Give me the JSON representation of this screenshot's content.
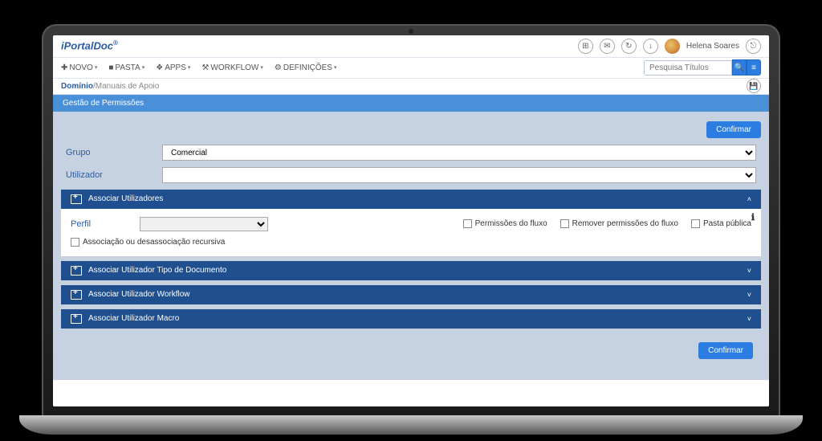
{
  "brand": "iPortalDoc",
  "brand_sup": "®",
  "user": "Helena Soares",
  "menu": {
    "novo": "NOVO",
    "pasta": "PASTA",
    "apps": "APPS",
    "workflow": "WORKFLOW",
    "defin": "DEFINIÇÕES"
  },
  "search": {
    "placeholder": "Pesquisa Títulos"
  },
  "breadcrumb": {
    "root": "Domínio",
    "sep": "/",
    "child": "Manuais de Apoio"
  },
  "section_title": "Gestão de Permissões",
  "confirm": "Confirmar",
  "labels": {
    "grupo": "Grupo",
    "utilizador": "Utilizador",
    "perfil": "Perfil"
  },
  "values": {
    "grupo": "Comercial",
    "utilizador": ""
  },
  "accordions": {
    "assoc_users": "Associar Utilizadores",
    "assoc_tipo": "Associar Utilizador Tipo de Documento",
    "assoc_workflow": "Associar Utilizador Workflow",
    "assoc_macro": "Associar Utilizador Macro"
  },
  "checks": {
    "perm_fluxo": "Permissões do fluxo",
    "remover_perm": "Remover permissões do fluxo",
    "pasta_pub": "Pasta pública",
    "assoc_recur": "Associação ou desassociação recursiva"
  }
}
